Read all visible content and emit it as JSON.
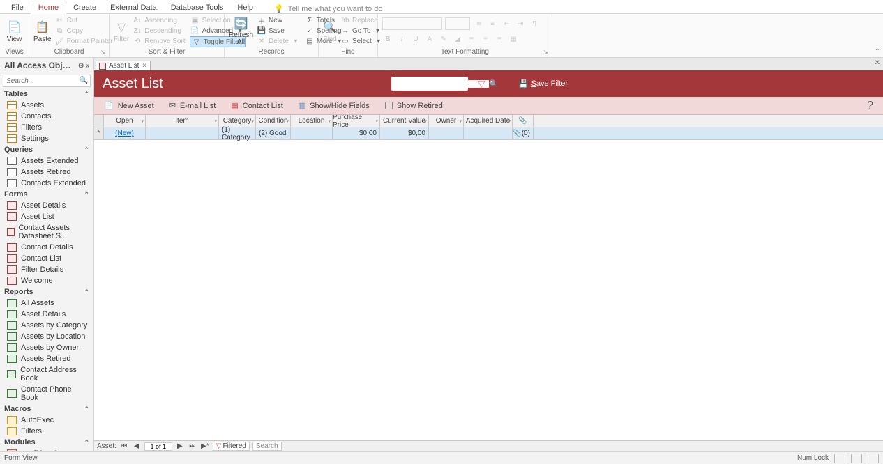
{
  "tabs": {
    "file": "File",
    "home": "Home",
    "create": "Create",
    "external": "External Data",
    "dbtools": "Database Tools",
    "help": "Help",
    "tellme": "Tell me what you want to do"
  },
  "ribbon": {
    "views": {
      "label": "Views",
      "view": "View"
    },
    "clipboard": {
      "label": "Clipboard",
      "paste": "Paste",
      "cut": "Cut",
      "copy": "Copy",
      "fmt": "Format Painter"
    },
    "sort": {
      "label": "Sort & Filter",
      "filter": "Filter",
      "asc": "Ascending",
      "desc": "Descending",
      "remove": "Remove Sort",
      "selection": "Selection",
      "advanced": "Advanced",
      "toggle": "Toggle Filter"
    },
    "records": {
      "label": "Records",
      "refresh": "Refresh\nAll",
      "new": "New",
      "save": "Save",
      "delete": "Delete",
      "totals": "Totals",
      "spelling": "Spelling",
      "more": "More"
    },
    "find": {
      "label": "Find",
      "find": "Find",
      "replace": "Replace",
      "goto": "Go To",
      "select": "Select"
    },
    "textfmt": {
      "label": "Text Formatting"
    }
  },
  "nav": {
    "title": "All Access Obj…",
    "search_ph": "Search...",
    "groups": {
      "tables": {
        "h": "Tables",
        "items": [
          "Assets",
          "Contacts",
          "Filters",
          "Settings"
        ]
      },
      "queries": {
        "h": "Queries",
        "items": [
          "Assets Extended",
          "Assets Retired",
          "Contacts Extended"
        ]
      },
      "forms": {
        "h": "Forms",
        "items": [
          "Asset Details",
          "Asset List",
          "Contact Assets Datasheet S...",
          "Contact Details",
          "Contact List",
          "Filter Details",
          "Welcome"
        ]
      },
      "reports": {
        "h": "Reports",
        "items": [
          "All Assets",
          "Asset Details",
          "Assets by Category",
          "Assets by Location",
          "Assets by Owner",
          "Assets Retired",
          "Contact Address Book",
          "Contact Phone Book"
        ]
      },
      "macros": {
        "h": "Macros",
        "items": [
          "AutoExec",
          "Filters"
        ]
      },
      "modules": {
        "h": "Modules",
        "items": [
          "modMapping"
        ]
      }
    }
  },
  "doc": {
    "tab": "Asset List",
    "title": "Asset List",
    "save_filter": "Save Filter",
    "toolbar": {
      "new_asset": "New Asset",
      "email": "E-mail List",
      "contact": "Contact List",
      "showhide": "Show/Hide Fields",
      "retired": "Show Retired"
    },
    "cols": {
      "open": "Open",
      "item": "Item",
      "category": "Category",
      "condition": "Condition",
      "location": "Location",
      "price": "Purchase Price",
      "value": "Current Value",
      "owner": "Owner",
      "acquired": "Acquired Date"
    },
    "row": {
      "open": "(New)",
      "category": "(1) Category",
      "condition": "(2) Good",
      "price": "$0,00",
      "value": "$0,00",
      "attach": "(0)"
    },
    "recnav": {
      "label": "Asset:",
      "pos": "1 of 1",
      "filtered": "Filtered",
      "search": "Search"
    }
  },
  "status": {
    "view": "Form View",
    "numlock": "Num Lock"
  }
}
